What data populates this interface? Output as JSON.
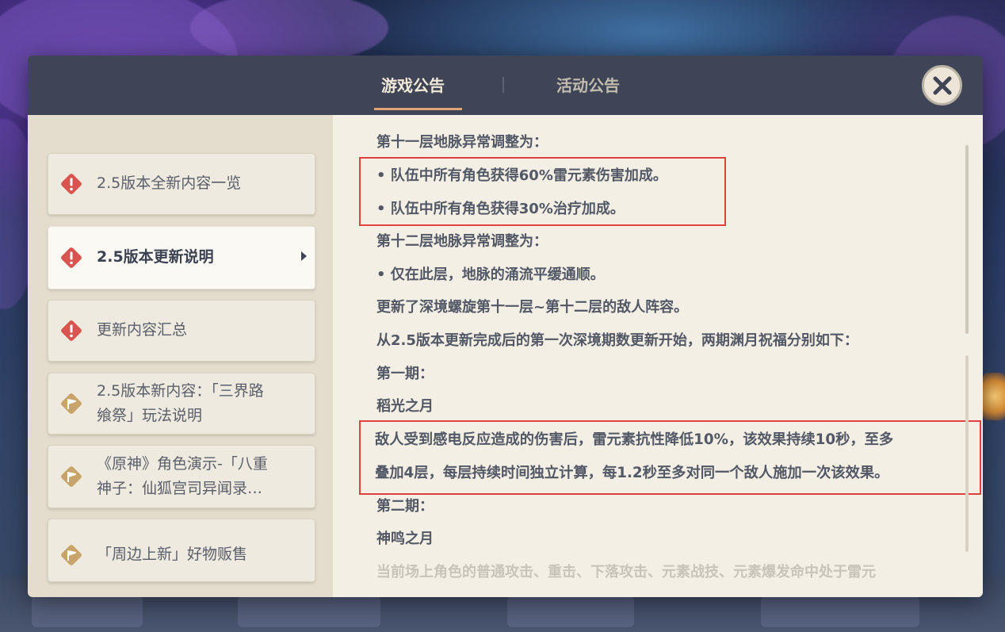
{
  "tabs": [
    {
      "label": "游戏公告",
      "active": true
    },
    {
      "label": "活动公告",
      "active": false
    }
  ],
  "close_icon": "close-x-icon",
  "sidebar": {
    "items": [
      {
        "label_lines": [
          "2.5版本全新内容一览"
        ],
        "icon": "alert-diamond-icon",
        "icon_color": "#d9534f",
        "active": false
      },
      {
        "label_lines": [
          "2.5版本更新说明"
        ],
        "icon": "alert-diamond-icon",
        "icon_color": "#d9534f",
        "active": true
      },
      {
        "label_lines": [
          "更新内容汇总"
        ],
        "icon": "alert-diamond-icon",
        "icon_color": "#d9534f",
        "active": false
      },
      {
        "label_lines": [
          "2.5版本新内容：「三界路",
          "飨祭」玩法说明"
        ],
        "icon": "flag-diamond-icon",
        "icon_color": "#c9a46a",
        "active": false
      },
      {
        "label_lines": [
          "《原神》角色演示-「八重",
          "神子：仙狐宫司异闻录…"
        ],
        "icon": "flag-diamond-icon",
        "icon_color": "#c9a46a",
        "active": false
      },
      {
        "label_lines": [
          "「周边上新」好物贩售"
        ],
        "icon": "flag-diamond-icon",
        "icon_color": "#c9a46a",
        "active": false
      }
    ]
  },
  "content": {
    "lines": [
      "第十一层地脉异常调整为：",
      "• 队伍中所有角色获得60%雷元素伤害加成。",
      "• 队伍中所有角色获得30%治疗加成。",
      "第十二层地脉异常调整为：",
      "• 仅在此层，地脉的涌流平缓通顺。",
      "更新了深境螺旋第十一层~第十二层的敌人阵容。",
      "从2.5版本更新完成后的第一次深境期数更新开始，两期渊月祝福分别如下：",
      "第一期：",
      "稻光之月",
      "敌人受到感电反应造成的伤害后，雷元素抗性降低10%，该效果持续10秒，至多",
      "叠加4层，每层持续时间独立计算，每1.2秒至多对同一个敌人施加一次该效果。",
      "第二期：",
      "神鸣之月",
      "当前场上角色的普通攻击、重击、下落攻击、元素战技、元素爆发命中处于雷元"
    ]
  },
  "colors": {
    "highlight_box": "#e0403e",
    "active_tab_underline": "#e0a576",
    "alert_icon": "#d9534f",
    "info_icon": "#c9a46a"
  }
}
